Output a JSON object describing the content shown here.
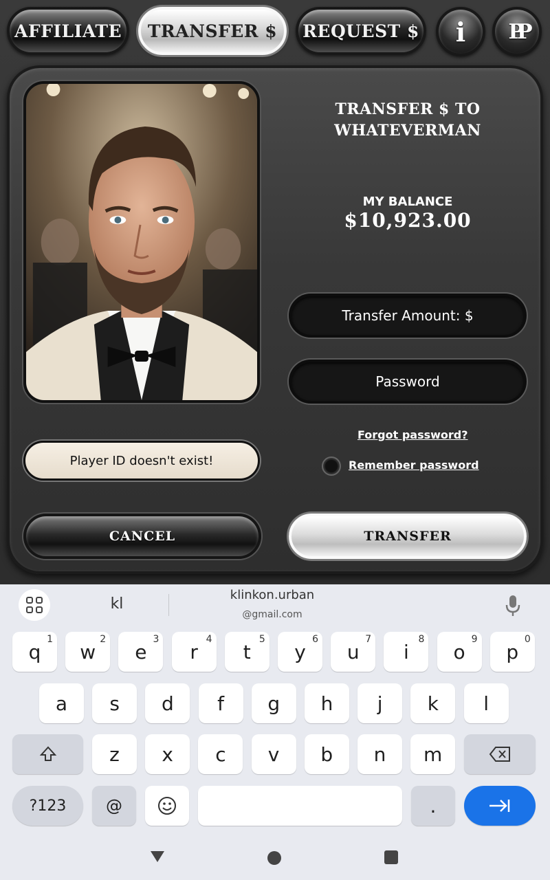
{
  "nav": {
    "affiliate": "AFFILIATE",
    "transfer": "TRANSFER $",
    "request": "REQUEST $",
    "info": "i",
    "logo": "PP"
  },
  "card": {
    "title": "TRANSFER $ TO WHATEVERMAN",
    "balance_label": "MY BALANCE",
    "balance_value": "$10,923.00",
    "amount_placeholder": "Transfer Amount: $",
    "password_placeholder": "Password",
    "forgot_password": "Forgot password?",
    "remember_password": "Remember password",
    "error_message": "Player ID doesn't exist!",
    "cancel": "CANCEL",
    "transfer": "TRANSFER"
  },
  "keyboard": {
    "suggestion_1": "kl",
    "suggestion_2_main": "klinkon.urban",
    "suggestion_2_sub": "@gmail.com",
    "row1": [
      {
        "k": "q",
        "h": "1"
      },
      {
        "k": "w",
        "h": "2"
      },
      {
        "k": "e",
        "h": "3"
      },
      {
        "k": "r",
        "h": "4"
      },
      {
        "k": "t",
        "h": "5"
      },
      {
        "k": "y",
        "h": "6"
      },
      {
        "k": "u",
        "h": "7"
      },
      {
        "k": "i",
        "h": "8"
      },
      {
        "k": "o",
        "h": "9"
      },
      {
        "k": "p",
        "h": "0"
      }
    ],
    "row2": [
      "a",
      "s",
      "d",
      "f",
      "g",
      "h",
      "j",
      "k",
      "l"
    ],
    "row3": [
      "z",
      "x",
      "c",
      "v",
      "b",
      "n",
      "m"
    ],
    "sym_label": "?123",
    "at_label": "@",
    "period_label": "."
  },
  "colors": {
    "enter_key": "#1a73e8",
    "keyboard_bg": "#e8eaf0"
  },
  "icons": [
    "info-icon",
    "pp-logo-icon",
    "apps-grid-icon",
    "mic-icon",
    "shift-icon",
    "backspace-icon",
    "emoji-icon",
    "enter-arrow-icon",
    "nav-back-icon",
    "nav-home-icon",
    "nav-recent-icon"
  ]
}
